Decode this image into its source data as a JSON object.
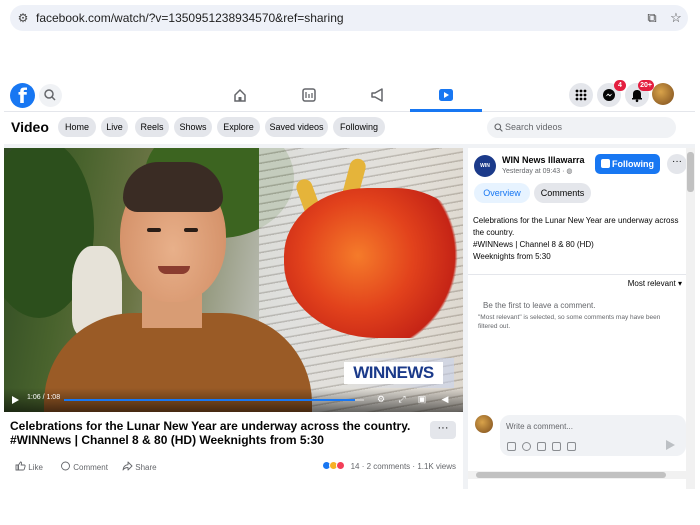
{
  "browser": {
    "url": "facebook.com/watch/?v=1350951238934570&ref=sharing",
    "tune_icon": "site-settings-icon",
    "install_icon": "install-app-icon",
    "bookmark_icon": "star-icon"
  },
  "topnav": {
    "logo": "f",
    "messenger_badge": "4",
    "notifications_badge": "20+",
    "active_tab": "watch"
  },
  "subbar": {
    "title": "Video",
    "chips": [
      "Home",
      "Live",
      "Reels",
      "Shows",
      "Explore",
      "Saved videos",
      "Following"
    ],
    "search_placeholder": "Search videos"
  },
  "video": {
    "brand_overlay": "WINNEWS",
    "time": "1:06 / 1:08",
    "progress": 0.97,
    "title": "Celebrations for the Lunar New Year are underway across the country. #WINNews | Channel 8 & 80 (HD) Weeknights from 5:30",
    "more_label": "···",
    "actions": [
      "Like",
      "Comment",
      "Share"
    ],
    "reactions_count": "14",
    "comments": "2 comments",
    "views": "1.1K views"
  },
  "panel": {
    "page_avatar_text": "WIN NEWS",
    "page_name": "WIN News Illawarra",
    "posted": "Yesterday at 09:43 · ",
    "follow_label": "Following",
    "tabs": [
      "Overview",
      "Comments"
    ],
    "desc_lines": [
      "Celebrations for the Lunar New Year are underway across the country.",
      "#WINNews | Channel 8 & 80 (HD)",
      "Weeknights from 5:30"
    ],
    "sort_label": "Most relevant",
    "first_comment": "Be the first to leave a comment.",
    "filter_note": "\"Most relevant\" is selected, so some comments may have been filtered out.",
    "composer_placeholder": "Write a comment..."
  },
  "colors": {
    "brand": "#1877f2",
    "badge": "#e41e3f",
    "win_navy": "#1b3a8a"
  }
}
